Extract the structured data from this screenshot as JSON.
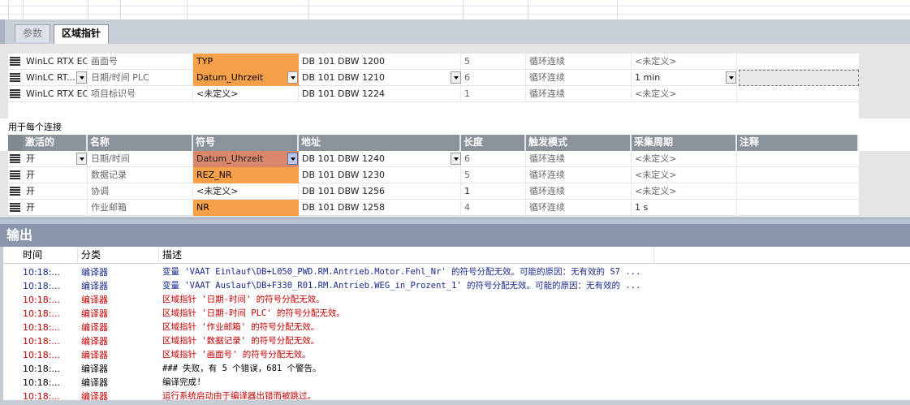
{
  "tabs": [
    {
      "label": "参数",
      "active": false
    },
    {
      "label": "区域指针",
      "active": true
    }
  ],
  "upper_rows": [
    {
      "plc": "WinLC RTX EC",
      "plc_dropdown": false,
      "name": "画面号",
      "symbol": "TYP",
      "symbol_dropdown": false,
      "address": "DB 101 DBW 1200",
      "address_dropdown": false,
      "length": "5",
      "trigger": "循环连续",
      "cycle": "<未定义>",
      "cycle_dropdown": false
    },
    {
      "plc": "WinLC RT...",
      "plc_dropdown": true,
      "name": "日期/时间 PLC",
      "symbol": "Datum_Uhrzeit",
      "symbol_dropdown": true,
      "address": "DB 101 DBW 1210",
      "address_dropdown": true,
      "length": "6",
      "trigger": "循环连续",
      "cycle": "1 min",
      "cycle_dropdown": true
    },
    {
      "plc": "WinLC RTX EC",
      "plc_dropdown": false,
      "name": "项目标识号",
      "symbol": "<未定义>",
      "symbol_dropdown": false,
      "address": "DB 101 DBW 1224",
      "address_dropdown": false,
      "length": "1",
      "trigger": "循环连续",
      "cycle": "<未定义>",
      "cycle_dropdown": false
    }
  ],
  "lower_section_title": "用于每个连接",
  "lower_headers": [
    "激活的",
    "名称",
    "符号",
    "地址",
    "长度",
    "触发模式",
    "采集周期",
    "注释"
  ],
  "lower_rows": [
    {
      "active": "开",
      "active_dropdown": true,
      "name": "日期/时间",
      "symbol": "Datum_Uhrzeit",
      "symbol_style": "selected",
      "address": "DB 101 DBW 1240",
      "address_dropdown": true,
      "length": "6",
      "trigger": "循环连续",
      "cycle": "<未定义>"
    },
    {
      "active": "开",
      "active_dropdown": false,
      "name": "数据记录",
      "symbol": "REZ_NR",
      "symbol_style": "orange",
      "address": "DB 101 DBW 1230",
      "address_dropdown": false,
      "length": "5",
      "trigger": "循环连续",
      "cycle": "<未定义>"
    },
    {
      "active": "开",
      "active_dropdown": false,
      "name": "协调",
      "symbol": "<未定义>",
      "symbol_style": "plain",
      "address": "DB 101 DBW 1256",
      "address_dropdown": false,
      "length": "1",
      "trigger": "循环连续",
      "cycle": "<未定义>"
    },
    {
      "active": "开",
      "active_dropdown": false,
      "name": "作业邮箱",
      "symbol": "NR",
      "symbol_style": "orange",
      "address": "DB 101 DBW 1258",
      "address_dropdown": false,
      "length": "4",
      "trigger": "循环连续",
      "cycle": "1 s"
    }
  ],
  "output": {
    "title": "输出",
    "headers": [
      "时间",
      "分类",
      "描述"
    ],
    "rows": [
      {
        "time": "10:18:...",
        "category": "编译器",
        "desc": "变量 'VAAT Einlauf\\DB+L050_PWD.RM.Antrieb.Motor.Fehl_Nr' 的符号分配无效。可能的原因：无有效的 S7 ...",
        "severity": "info"
      },
      {
        "time": "10:18:...",
        "category": "编译器",
        "desc": "变量 'VAAT Auslauf\\DB+F330_R01.RM.Antrieb.WEG_in_Prozent_1' 的符号分配无效。可能的原因：无有效的 ...",
        "severity": "info"
      },
      {
        "time": "10:18:...",
        "category": "编译器",
        "desc": "区域指针 '日期-时间' 的符号分配无效。",
        "severity": "error"
      },
      {
        "time": "10:18:...",
        "category": "编译器",
        "desc": "区域指针 '日期-时间 PLC' 的符号分配无效。",
        "severity": "error"
      },
      {
        "time": "10:18:...",
        "category": "编译器",
        "desc": "区域指针 '作业邮箱' 的符号分配无效。",
        "severity": "error"
      },
      {
        "time": "10:18:...",
        "category": "编译器",
        "desc": "区域指针 '数据记录' 的符号分配无效。",
        "severity": "error"
      },
      {
        "time": "10:18:...",
        "category": "编译器",
        "desc": "区域指针 '画面号' 的符号分配无效。",
        "severity": "error"
      },
      {
        "time": "10:18:...",
        "category": "编译器",
        "desc": "### 失败，有 5 个错误，681 个警告。",
        "severity": "plain"
      },
      {
        "time": "10:18:...",
        "category": "编译器",
        "desc": "编译完成!",
        "severity": "plain"
      },
      {
        "time": "10:18:...",
        "category": "编译器",
        "desc": "运行系统启动由于编译器出错而被跳过。",
        "severity": "error"
      }
    ]
  },
  "colors": {
    "symbol_assigned": "#f7a04a",
    "symbol_selected": "#d9866a",
    "header_bg": "#8a929b",
    "output_title_bg": "#8a97ab",
    "info_text": "#1a2a8a",
    "error_text": "#c00000"
  }
}
